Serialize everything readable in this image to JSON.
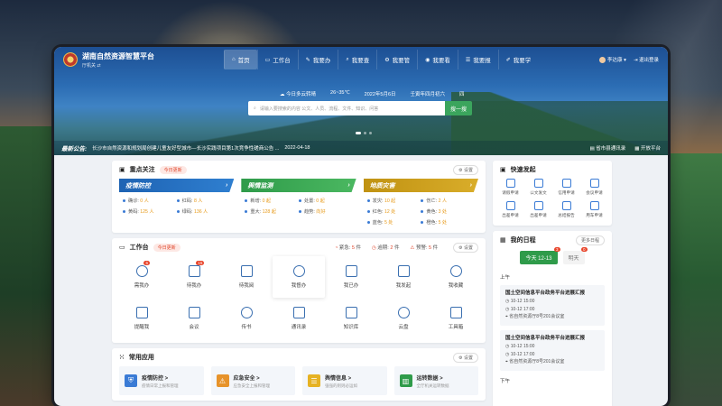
{
  "app": {
    "title": "湖南自然资源智慧平台",
    "org": "厅机关 ⇄"
  },
  "nav": [
    {
      "label": "首页",
      "icon": "⌂"
    },
    {
      "label": "工作台",
      "icon": "▭"
    },
    {
      "label": "我要办",
      "icon": "✎"
    },
    {
      "label": "我要查",
      "icon": "⌕"
    },
    {
      "label": "我要管",
      "icon": "⚙"
    },
    {
      "label": "我要看",
      "icon": "◉"
    },
    {
      "label": "我要报",
      "icon": "☰"
    },
    {
      "label": "我要学",
      "icon": "✐"
    }
  ],
  "user": {
    "name": "李达康 ▾",
    "logout": "退出登录"
  },
  "weather": {
    "text": "今日多云转晴",
    "temp": "26~35℃",
    "date": "2022年5月6日",
    "lunar": "壬寅年四月初六",
    "weekday": "四"
  },
  "search": {
    "placeholder": "请输入要搜索的内容 公文、人员、流程、文件、知识、问答",
    "button": "搜一搜"
  },
  "notice": {
    "tag": "最新公告:",
    "text": "长沙市自然资源和规划局创建儿童友好型城市—长沙实践项目第1次竞争性磋商公告 ...",
    "date": "2022-04-18",
    "links": [
      "省市县通讯录",
      "开放平台"
    ]
  },
  "focus": {
    "title": "重点关注",
    "tag": "今日更新",
    "settings": "设置",
    "cards": [
      {
        "title": "疫情防控",
        "items": [
          {
            "k": "确诊:",
            "v": "0 人"
          },
          {
            "k": "红码:",
            "v": "8 人"
          },
          {
            "k": "黄码:",
            "v": "125 人"
          },
          {
            "k": "绿码:",
            "v": "136 人"
          }
        ]
      },
      {
        "title": "舆情监测",
        "items": [
          {
            "k": "新增:",
            "v": "0 起"
          },
          {
            "k": "处置:",
            "v": "0 起"
          },
          {
            "k": "重大:",
            "v": "128 起"
          },
          {
            "k": "趋势:",
            "v": "向好"
          }
        ]
      },
      {
        "title": "地质灾害",
        "items": [
          {
            "k": "发灾:",
            "v": "10 起"
          },
          {
            "k": "伤亡:",
            "v": "2 人"
          },
          {
            "k": "红色:",
            "v": "12 处"
          },
          {
            "k": "黄色:",
            "v": "3 处"
          },
          {
            "k": "蓝色:",
            "v": "5 处"
          },
          {
            "k": "橙色:",
            "v": "5 处"
          }
        ]
      }
    ]
  },
  "workbench": {
    "title": "工作台",
    "tag": "今日更新",
    "settings": "设置",
    "stats": [
      {
        "k": "紧急:",
        "v": "5",
        "u": "件"
      },
      {
        "k": "逾期:",
        "v": "2",
        "u": "件"
      },
      {
        "k": "预警:",
        "v": "5",
        "u": "件"
      }
    ],
    "items": [
      {
        "label": "需我办",
        "badge": "6"
      },
      {
        "label": "待我办",
        "badge": "15"
      },
      {
        "label": "待我阅",
        "badge": ""
      },
      {
        "label": "我督办",
        "badge": ""
      },
      {
        "label": "我已办",
        "badge": ""
      },
      {
        "label": "我发起",
        "badge": ""
      },
      {
        "label": "我收藏",
        "badge": ""
      },
      {
        "label": "提醒我",
        "badge": ""
      },
      {
        "label": "会议",
        "badge": ""
      },
      {
        "label": "传书",
        "badge": ""
      },
      {
        "label": "通讯录",
        "badge": ""
      },
      {
        "label": "知识库",
        "badge": ""
      },
      {
        "label": "云盘",
        "badge": ""
      },
      {
        "label": "工具箱",
        "badge": ""
      }
    ]
  },
  "apps": {
    "title": "常用应用",
    "settings": "设置",
    "items": [
      {
        "title": "疫情防控 >",
        "sub": "疫情日常上报和管理",
        "color": "#3a7bd5",
        "icon": "⛨"
      },
      {
        "title": "应急安全 >",
        "sub": "应急安全上报和管理",
        "color": "#e7932a",
        "icon": "⚠"
      },
      {
        "title": "舆情信息 >",
        "sub": "强强的则则必运如",
        "color": "#e6b223",
        "icon": "☰"
      },
      {
        "title": "运转数据 >",
        "sub": "全厅机关运转数据",
        "color": "#2f9b4a",
        "icon": "▥"
      }
    ]
  },
  "quick": {
    "title": "快速发起",
    "items": [
      "请假申请",
      "公文发文",
      "信用申请",
      "会议申请",
      "出差申请",
      "出差申请",
      "总结报告",
      "用车申请"
    ]
  },
  "schedule": {
    "title": "我的日程",
    "more": "更多日程",
    "tabs": [
      {
        "label": "今天 12-13",
        "badge": "3"
      },
      {
        "label": "明天",
        "badge": "0"
      }
    ],
    "am": "上午",
    "pm": "下午",
    "events": [
      {
        "title": "国土空间信息平台政务平台进展汇报",
        "start": "10-12 15:00",
        "end": "10-12 17:00",
        "place": "省自然资源厅8号201会议室"
      },
      {
        "title": "国土空间信息平台政务平台进展汇报",
        "start": "10-12 15:00",
        "end": "10-12 17:00",
        "place": "省自然资源厅8号201会议室"
      }
    ]
  }
}
